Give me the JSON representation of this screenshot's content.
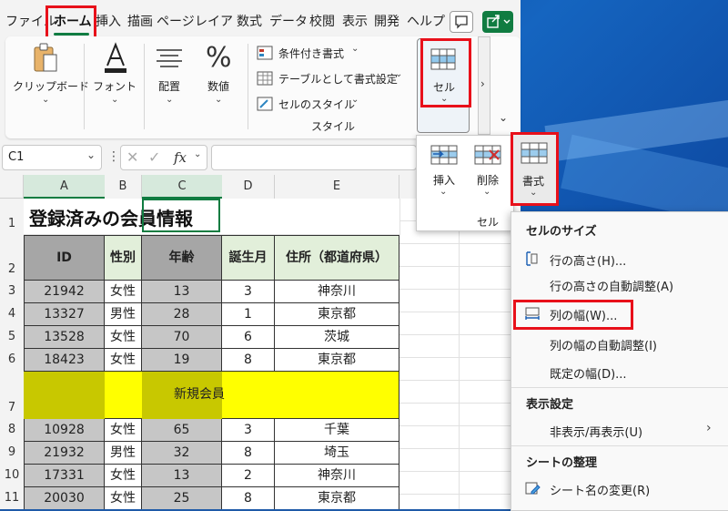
{
  "tabs": [
    "ファイル",
    "ホーム",
    "挿入",
    "描画",
    "ページ",
    "レイア",
    "数式",
    "データ",
    "校閲",
    "表示",
    "開発",
    "ヘルプ"
  ],
  "ribbon": {
    "clipboard": "クリップボード",
    "font": "フォント",
    "alignment": "配置",
    "number": "数値",
    "conditional_format": "条件付き書式",
    "format_as_table": "テーブルとして書式設定",
    "cell_styles": "セルのスタイル",
    "styles_group": "スタイル",
    "cells": "セル",
    "more": "›"
  },
  "formula_bar": {
    "name_box": "C1",
    "fx": "fx"
  },
  "cell_popup": {
    "insert": "挿入",
    "delete": "削除",
    "format": "書式",
    "group": "セル"
  },
  "sheet": {
    "columns": [
      "A",
      "B",
      "C",
      "D",
      "E"
    ],
    "row_numbers": [
      "1",
      "2",
      "3",
      "4",
      "5",
      "6",
      "7",
      "8",
      "9",
      "10",
      "11"
    ],
    "title": "登録済みの会員情報",
    "headers": [
      "ID",
      "性別",
      "年齢",
      "誕生月",
      "住所（都道府県）"
    ],
    "rows_before": [
      [
        "21942",
        "女性",
        "13",
        "3",
        "神奈川"
      ],
      [
        "13327",
        "男性",
        "28",
        "1",
        "東京都"
      ],
      [
        "13528",
        "女性",
        "70",
        "6",
        "茨城"
      ],
      [
        "18423",
        "女性",
        "19",
        "8",
        "東京都"
      ]
    ],
    "new_member": "新規会員",
    "rows_after": [
      [
        "10928",
        "女性",
        "65",
        "3",
        "千葉"
      ],
      [
        "21932",
        "男性",
        "32",
        "8",
        "埼玉"
      ],
      [
        "17331",
        "女性",
        "13",
        "2",
        "神奈川"
      ],
      [
        "20030",
        "女性",
        "25",
        "8",
        "東京都"
      ]
    ]
  },
  "format_menu": {
    "cell_size": "セルのサイズ",
    "row_height": "行の高さ(H)...",
    "autofit_row": "行の高さの自動調整(A)",
    "column_width": "列の幅(W)...",
    "autofit_column": "列の幅の自動調整(I)",
    "default_width": "既定の幅(D)...",
    "visibility": "表示設定",
    "hide_unhide": "非表示/再表示(U)",
    "organize_sheets": "シートの整理",
    "rename_sheet": "シート名の変更(R)"
  },
  "colors": {
    "accent_green": "#107c41",
    "highlight_red": "#e8101a",
    "header_green": "#e2efda",
    "selection_gray": "#c6c6c6",
    "yellow": "#ffff00"
  }
}
